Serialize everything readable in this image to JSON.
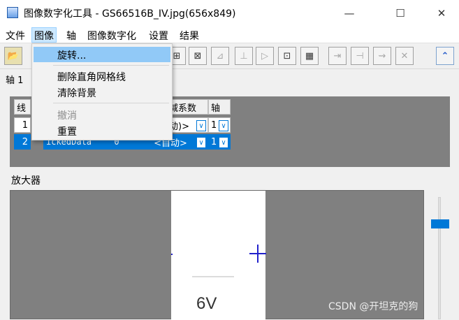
{
  "window": {
    "title": "图像数字化工具 - GS66516B_IV.jpg(656x849)",
    "minimize": "—",
    "maximize": "☐",
    "close": "✕"
  },
  "menubar": {
    "items": [
      "文件",
      "图像",
      "轴",
      "图像数字化",
      "设置",
      "结果"
    ]
  },
  "toolbar": {
    "open_icon": "📂",
    "icons": [
      "⊞",
      "⊠",
      "⊿",
      "⊥",
      "▷",
      "⊡",
      "▦",
      "⇥",
      "⊣",
      "⇝",
      "✕"
    ],
    "expand": "⌃"
  },
  "axis_tab": {
    "label": "轴 1"
  },
  "grid": {
    "header": {
      "col0": "线",
      "col3": "减系数",
      "col4": "轴"
    },
    "rows": [
      {
        "num": "1",
        "name": "",
        "value": "",
        "factor": "动)>",
        "axis": "1"
      },
      {
        "num": "2",
        "name": "ickedData",
        "value": "0",
        "factor": "<自动>",
        "axis": "1"
      }
    ],
    "dropdown_arrow": "∨"
  },
  "magnifier": {
    "label": "放大器",
    "image_text": "6V"
  },
  "watermark": "CSDN @开坦克的狗",
  "image_menu": {
    "items": [
      {
        "label": "旋转...",
        "state": "hover"
      },
      {
        "label": "删除直角网格线",
        "state": "normal"
      },
      {
        "label": "清除背景",
        "state": "normal"
      },
      {
        "label": "撤消",
        "state": "disabled"
      },
      {
        "label": "重置",
        "state": "normal"
      }
    ]
  }
}
